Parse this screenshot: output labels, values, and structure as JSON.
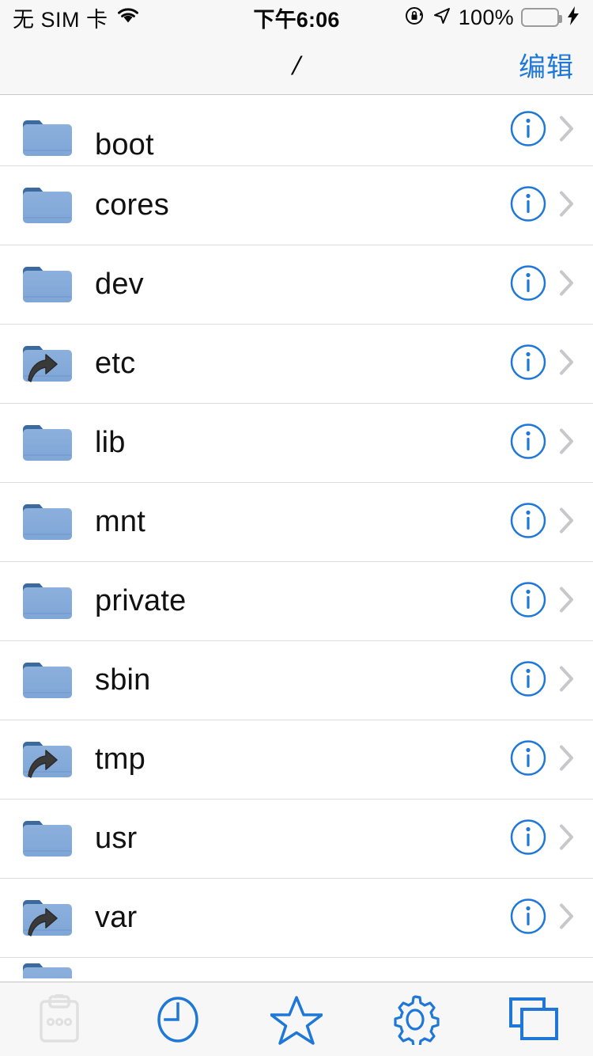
{
  "status_bar": {
    "carrier": "无 SIM 卡",
    "wifi_icon": "wifi-icon",
    "time": "下午6:06",
    "rotation_lock_icon": "rotation-lock-icon",
    "location_icon": "location-arrow-icon",
    "battery_percent": "100%",
    "battery_icon": "battery-full-icon",
    "charging_icon": "lightning-bolt-icon",
    "battery_color": "#4cd964"
  },
  "nav_bar": {
    "title": "/",
    "edit_label": "编辑",
    "accent_color": "#1f78d8"
  },
  "list": {
    "items": [
      {
        "name": "boot",
        "type": "folder",
        "info": "info-button",
        "chevron": "disclosure-chevron-icon"
      },
      {
        "name": "cores",
        "type": "folder",
        "info": "info-button",
        "chevron": "disclosure-chevron-icon"
      },
      {
        "name": "dev",
        "type": "folder",
        "info": "info-button",
        "chevron": "disclosure-chevron-icon"
      },
      {
        "name": "etc",
        "type": "symlink",
        "info": "info-button",
        "chevron": "disclosure-chevron-icon"
      },
      {
        "name": "lib",
        "type": "folder",
        "info": "info-button",
        "chevron": "disclosure-chevron-icon"
      },
      {
        "name": "mnt",
        "type": "folder",
        "info": "info-button",
        "chevron": "disclosure-chevron-icon"
      },
      {
        "name": "private",
        "type": "folder",
        "info": "info-button",
        "chevron": "disclosure-chevron-icon"
      },
      {
        "name": "sbin",
        "type": "folder",
        "info": "info-button",
        "chevron": "disclosure-chevron-icon"
      },
      {
        "name": "tmp",
        "type": "symlink",
        "info": "info-button",
        "chevron": "disclosure-chevron-icon"
      },
      {
        "name": "usr",
        "type": "folder",
        "info": "info-button",
        "chevron": "disclosure-chevron-icon"
      },
      {
        "name": "var",
        "type": "symlink",
        "info": "info-button",
        "chevron": "disclosure-chevron-icon"
      }
    ],
    "folder_color": "#8cb0dd",
    "folder_tab_color": "#3d6a9e",
    "info_color": "#1f78d8",
    "chevron_color": "#c7c7cc"
  },
  "tab_bar": {
    "tabs": [
      {
        "icon": "clipboard-icon",
        "state": "disabled"
      },
      {
        "icon": "clock-icon",
        "state": "enabled"
      },
      {
        "icon": "star-icon",
        "state": "enabled"
      },
      {
        "icon": "gear-icon",
        "state": "enabled"
      },
      {
        "icon": "windows-icon",
        "state": "enabled"
      }
    ],
    "enabled_color": "#1f78d8",
    "disabled_color": "#e0e0e0"
  }
}
